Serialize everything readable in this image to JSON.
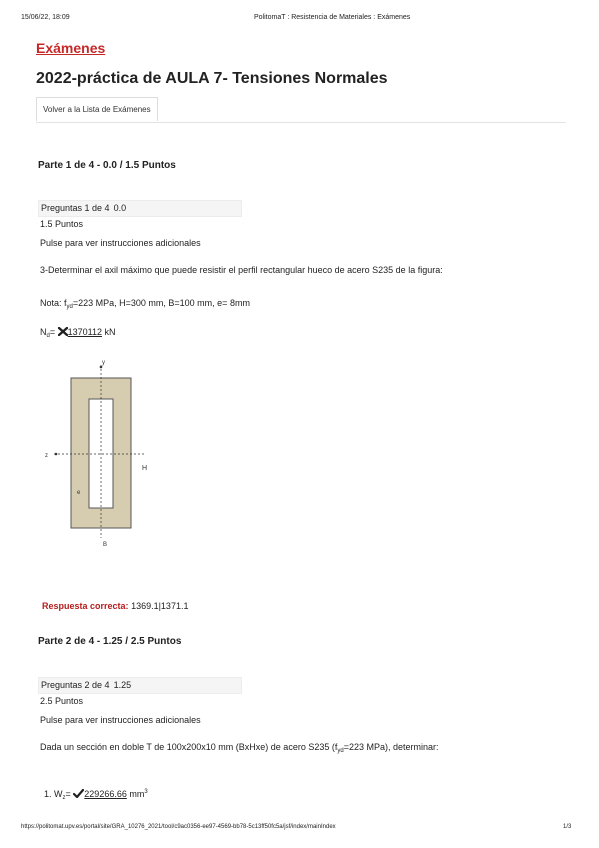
{
  "print_header": {
    "datetime": "15/06/22, 18:09",
    "site_title": "PolitomaT : Resistencia de Materiales : Exámenes"
  },
  "breadcrumb": "Exámenes",
  "exam_title": "2022-práctica de AULA 7- Tensiones Normales",
  "back_button": "Volver a la Lista de Exámenes",
  "parts": [
    {
      "heading": "Parte 1 de 4 - 0.0 / 1.5 Puntos",
      "question_label": "Preguntas 1 de 4",
      "score": "0.0",
      "points": "1.5 Puntos",
      "instructions_link": "Pulse para ver instrucciones adicionales",
      "statement": "3-Determinar el axil máximo que puede resistir el perfil rectangular hueco de acero S235 de la figura:",
      "note_prefix": "Nota: f",
      "note_sub": "yd",
      "note_rest": "=223 MPa, H=300 mm, B=100 mm, e= 8mm",
      "answer_prefix": "N",
      "answer_sub": "d",
      "answer_eq": "=",
      "answer_value": "1370112",
      "answer_unit": "kN",
      "figure_labels": {
        "y": "y",
        "z": "z",
        "h": "H",
        "e": "e",
        "b": "B"
      },
      "correct_label": "Respuesta correcta:",
      "correct_value": "1369.1|1371.1"
    },
    {
      "heading": "Parte 2 de 4 - 1.25 / 2.5 Puntos",
      "question_label": "Preguntas 2 de 4",
      "score": "1.25",
      "points": "2.5 Puntos",
      "instructions_link": "Pulse para ver instrucciones adicionales",
      "statement_prefix": "Dada un sección en doble T de 100x200x10 mm  (BxHxe) de acero S235 (f",
      "statement_sub": "yd",
      "statement_rest": "=223 MPa), determinar:",
      "item_prefix": "1. W",
      "item_sub": "z",
      "item_eq": "=",
      "item_value": "229266.66",
      "item_unit": "mm",
      "item_sup": "3"
    }
  ],
  "print_footer": {
    "url": "https://politomat.upv.es/portal/site/GRA_10276_2021/tool/c9ac0356-ee97-4569-bb78-5c13ff50fc5a/jsf/index/mainIndex",
    "page": "1/3"
  },
  "colors": {
    "accent_red": "#c62828",
    "section_fill": "#d6cdb0",
    "wrong": "#222222",
    "right": "#222222"
  }
}
